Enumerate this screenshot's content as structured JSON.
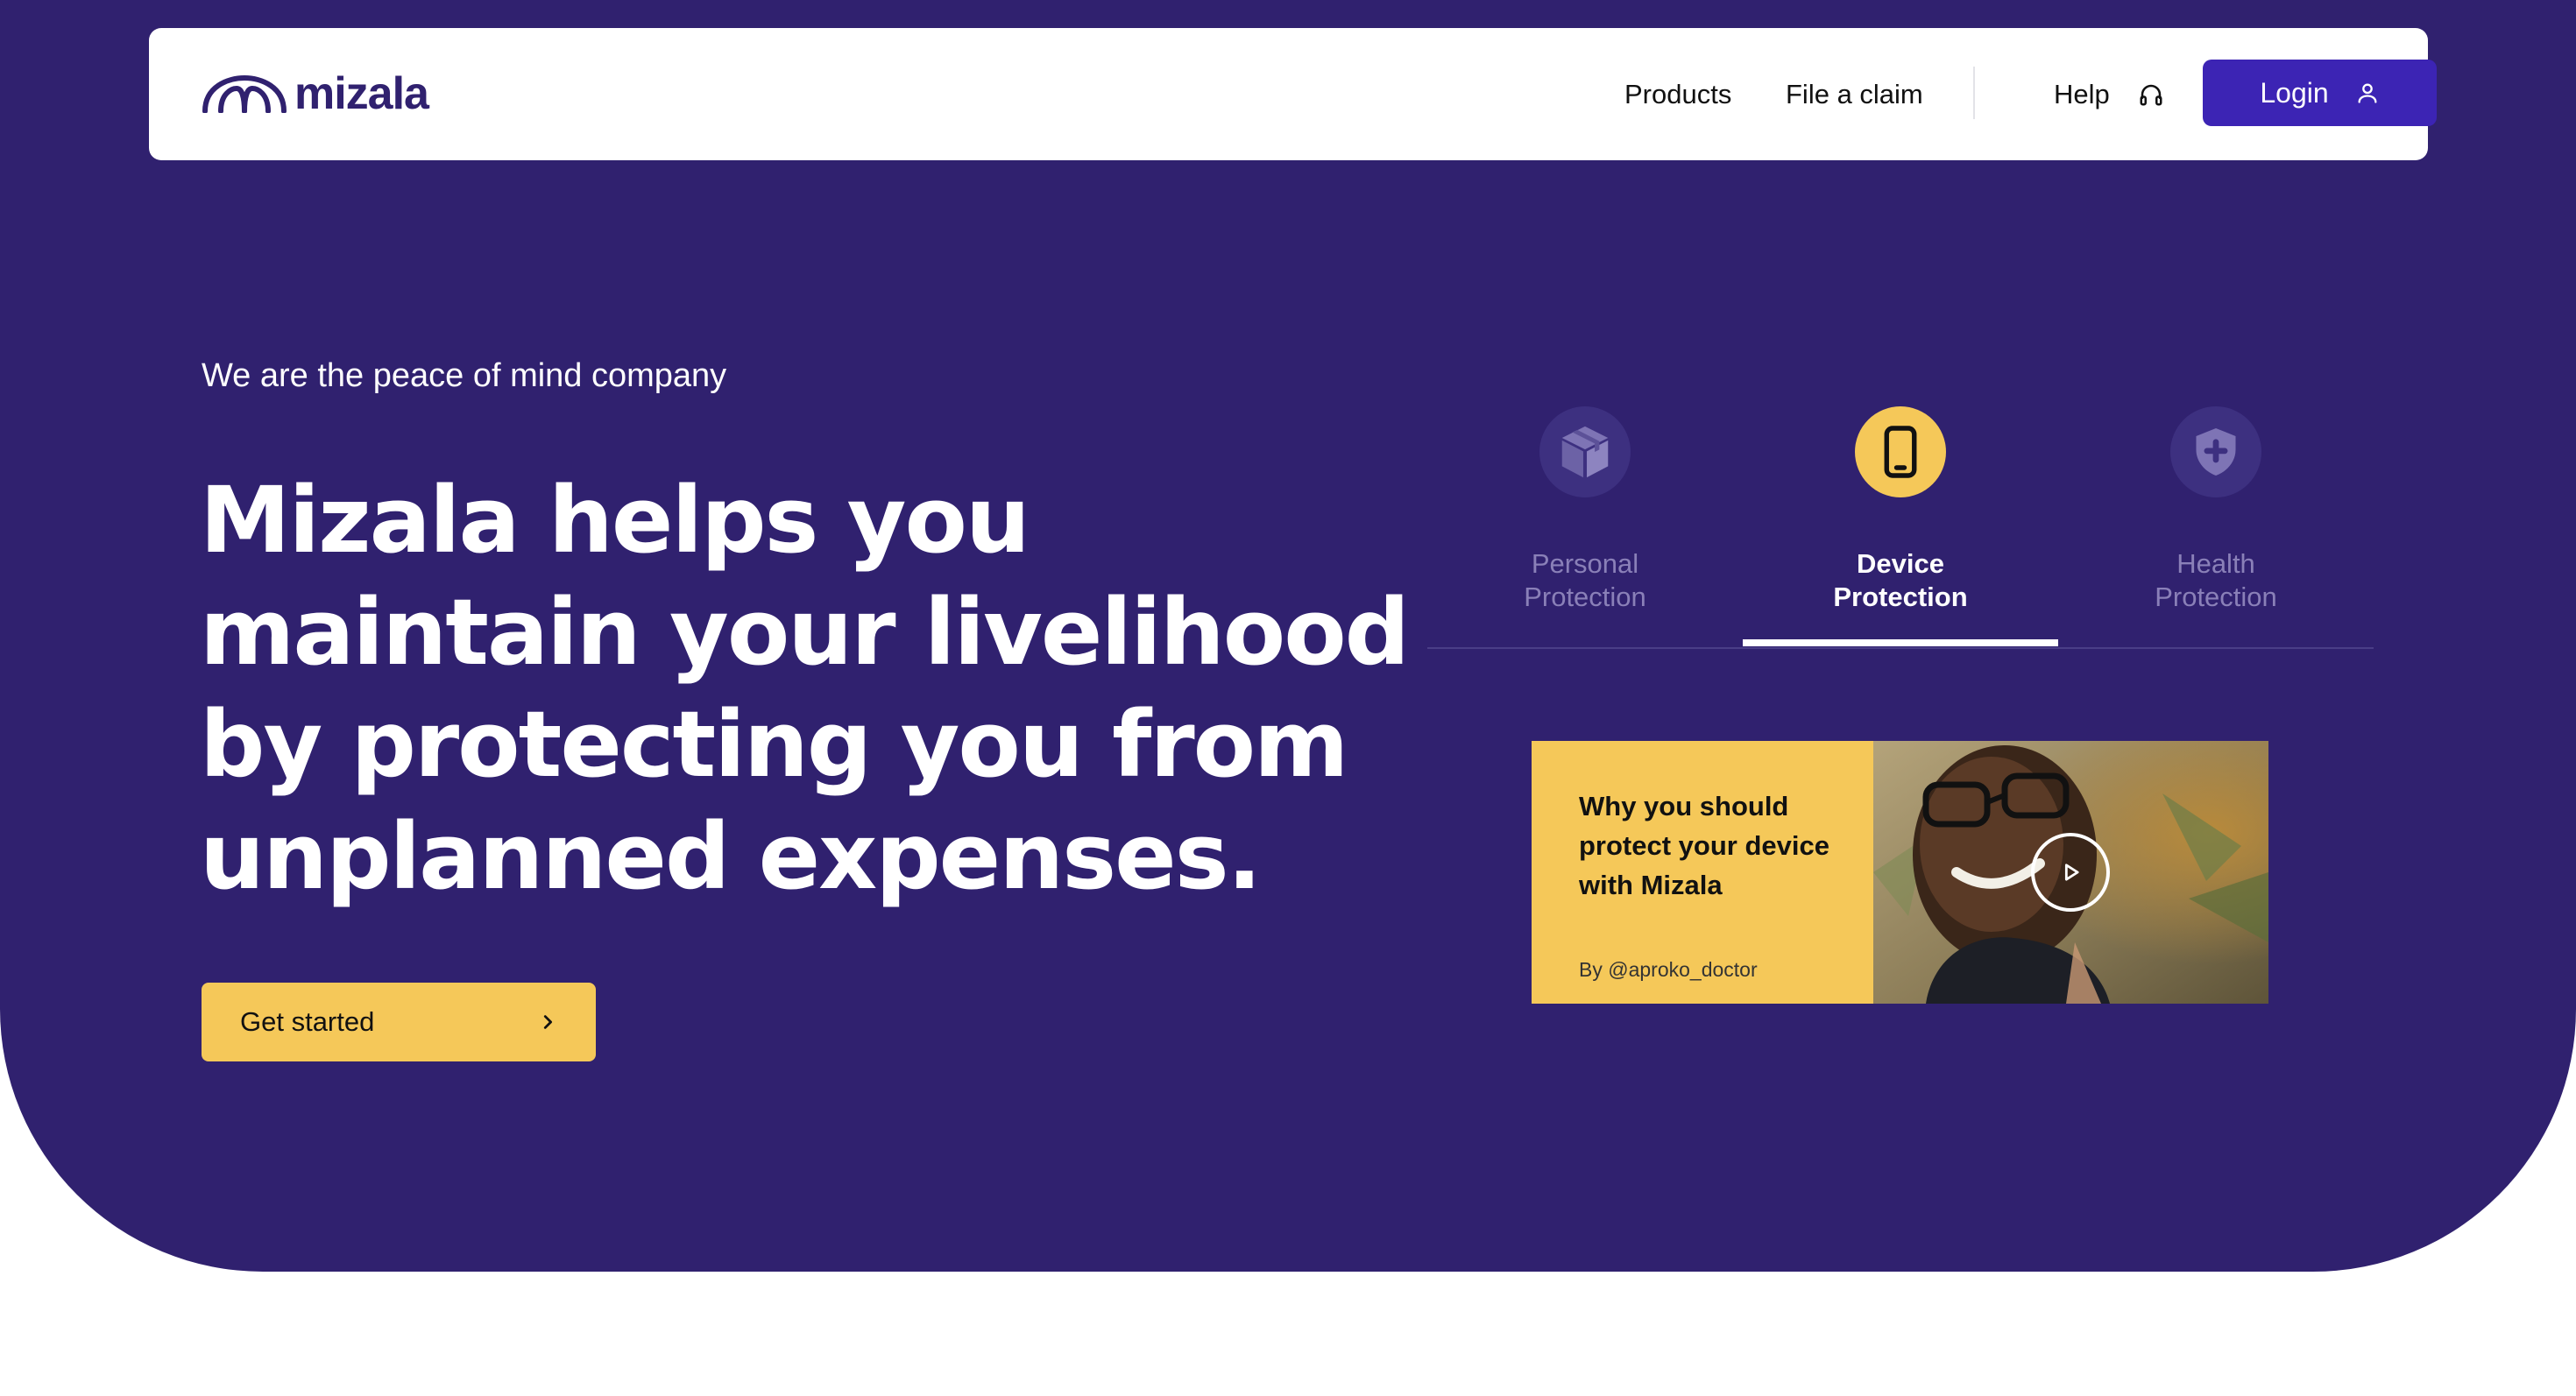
{
  "brand": {
    "name": "mizala",
    "color": "#30216f",
    "accent": "#f5c859",
    "button_color": "#3c24b4"
  },
  "nav": {
    "products": "Products",
    "file_claim": "File a claim",
    "help": "Help",
    "login": "Login"
  },
  "hero": {
    "tagline": "We are the peace of mind company",
    "headline": "Mizala helps you maintain your livelihood by protecting you from unplanned expenses.",
    "cta": "Get started"
  },
  "tabs": [
    {
      "label_line1": "Personal",
      "label_line2": "Protection",
      "icon": "box-icon",
      "active": false
    },
    {
      "label_line1": "Device",
      "label_line2": "Protection",
      "icon": "phone-icon",
      "active": true
    },
    {
      "label_line1": "Health",
      "label_line2": "Protection",
      "icon": "shield-plus-icon",
      "active": false
    }
  ],
  "video_card": {
    "title": "Why you should protect your device with Mizala",
    "byline": "By @aproko_doctor",
    "icon": "play-icon"
  }
}
